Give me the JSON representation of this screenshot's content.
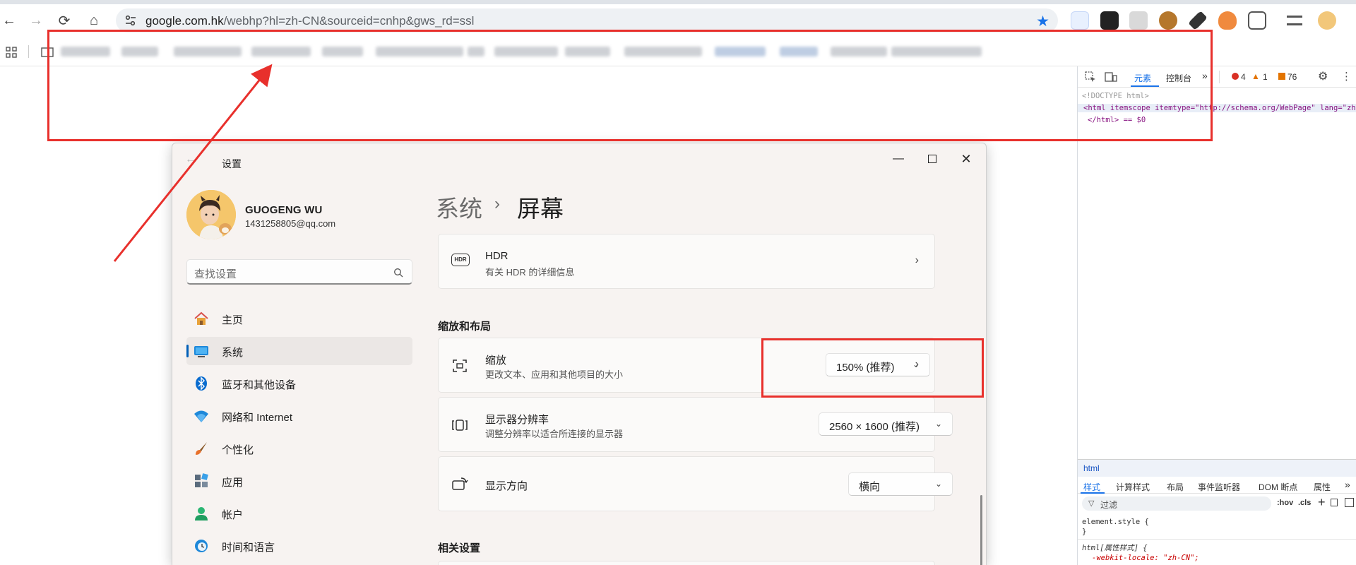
{
  "browser": {
    "url_host": "google.com.hk",
    "url_path": "/webhp?hl=zh-CN&sourceid=cnhp&gws_rd=ssl",
    "bookmarks_count": 14
  },
  "devtools": {
    "tabs": {
      "elements": "元素",
      "console": "控制台"
    },
    "counts": {
      "errors": "4",
      "warnings": "1",
      "issues": "76"
    },
    "code_lines": {
      "doctype": "<!DOCTYPE html>",
      "html_open": "<html itemscope itemtype=\"http://schema.org/WebPage\" lang=\"zh-",
      "html_close": "</html> == $0"
    },
    "breadcrumb": "html",
    "subtabs": [
      "样式",
      "计算样式",
      "布局",
      "事件监听器",
      "DOM 断点",
      "属性"
    ],
    "filter_placeholder": "过滤",
    "filter_tools": {
      "hov": ":hov",
      "cls": ".cls"
    },
    "styles": {
      "element_style": "element.style {",
      "brace_close": "}",
      "html_rule": "html[属性样式] {",
      "locale_prop": "-webkit-locale: \"zh-CN\";"
    }
  },
  "settings": {
    "window_title": "设置",
    "user": {
      "name": "GUOGENG WU",
      "email": "1431258805@qq.com"
    },
    "search_placeholder": "查找设置",
    "nav": [
      {
        "label": "主页",
        "icon": "home-icon"
      },
      {
        "label": "系统",
        "icon": "system-icon",
        "selected": true
      },
      {
        "label": "蓝牙和其他设备",
        "icon": "bluetooth-icon"
      },
      {
        "label": "网络和 Internet",
        "icon": "wifi-icon"
      },
      {
        "label": "个性化",
        "icon": "brush-icon"
      },
      {
        "label": "应用",
        "icon": "apps-icon"
      },
      {
        "label": "帐户",
        "icon": "account-icon"
      },
      {
        "label": "时间和语言",
        "icon": "clock-globe-icon"
      }
    ],
    "breadcrumb": {
      "parent": "系统",
      "separator": "›",
      "current": "屏幕"
    },
    "hdr": {
      "title": "HDR",
      "subtitle": "有关 HDR 的详细信息",
      "icon_text": "HDR"
    },
    "section_scale": "缩放和布局",
    "scale": {
      "title": "缩放",
      "subtitle": "更改文本、应用和其他项目的大小",
      "value": "150% (推荐)"
    },
    "resolution": {
      "title": "显示器分辨率",
      "subtitle": "调整分辨率以适合所连接的显示器",
      "value": "2560 × 1600 (推荐)"
    },
    "orientation": {
      "title": "显示方向",
      "value": "横向"
    },
    "section_related": "相关设置"
  },
  "colors": {
    "accent": "#005fb8",
    "annotation_red": "#e8302c",
    "browser_accent": "#1a73e8"
  }
}
